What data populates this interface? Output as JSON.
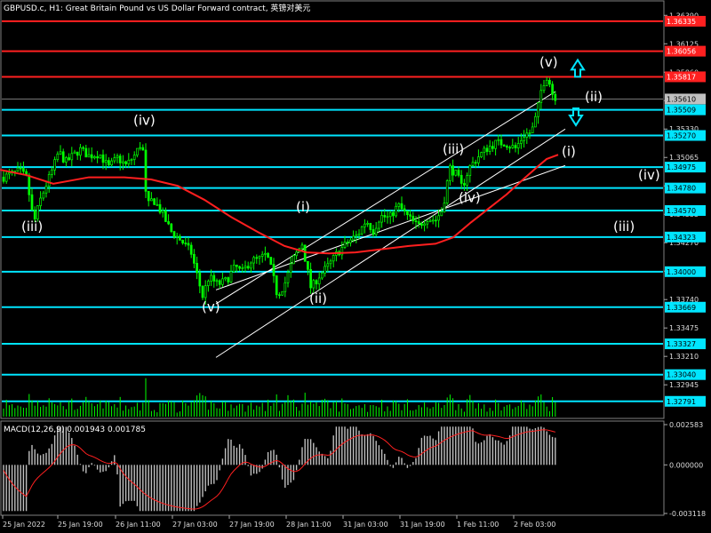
{
  "header": {
    "symbol_info": "GBPUSD.c, H1:  Great Britain Pound vs US Dollar Forward contract, 英镑对美元"
  },
  "macd": {
    "label": "MACD(12,26,9) 0.001943 0.001785",
    "axis_labels": [
      "0.002583",
      "0.000000",
      "-0.003118"
    ]
  },
  "colors": {
    "background": "#000000",
    "candle": "#00ff00",
    "level_line": "#00e5ff",
    "resistance_line": "#ff2020",
    "moving_average": "#ff1f1f",
    "channel": "#ffffff",
    "arrow": "#00e5ff",
    "current_price_bg": "#c0c0c0"
  },
  "chart_data": {
    "type": "candlestick",
    "title": "GBPUSD.c, H1:  Great Britain Pound vs US Dollar Forward contract, 英镑对美元",
    "ylim": [
      1.3264,
      1.365
    ],
    "grid": false,
    "price_axis_ticks": [
      "1.36390",
      "1.36125",
      "1.35860",
      "1.35595",
      "1.35330",
      "1.35065",
      "1.34800",
      "1.34535",
      "1.34270",
      "1.34005",
      "1.33740",
      "1.33475",
      "1.33210",
      "1.32945"
    ],
    "x_ticks": [
      "25 Jan 2022",
      "25 Jan 19:00",
      "26 Jan 11:00",
      "27 Jan 03:00",
      "27 Jan 19:00",
      "28 Jan 11:00",
      "31 Jan 03:00",
      "31 Jan 19:00",
      "1 Feb 11:00",
      "2 Feb 03:00"
    ],
    "current_price": "1.35610",
    "resistance_levels": [
      "1.36335",
      "1.36056",
      "1.35817"
    ],
    "support_levels": [
      "1.35509",
      "1.35270",
      "1.34975",
      "1.34780",
      "1.34570",
      "1.34323",
      "1.34000",
      "1.33669",
      "1.33327",
      "1.33040",
      "1.32791"
    ],
    "price_path": [
      [
        0,
        1.3487
      ],
      [
        10,
        1.349
      ],
      [
        22,
        1.3494
      ],
      [
        30,
        1.3487
      ],
      [
        38,
        1.3445
      ],
      [
        45,
        1.3466
      ],
      [
        52,
        1.3481
      ],
      [
        60,
        1.3497
      ],
      [
        66,
        1.3512
      ],
      [
        74,
        1.3502
      ],
      [
        82,
        1.3508
      ],
      [
        90,
        1.3514
      ],
      [
        100,
        1.3508
      ],
      [
        112,
        1.351
      ],
      [
        122,
        1.3497
      ],
      [
        132,
        1.3506
      ],
      [
        142,
        1.3499
      ],
      [
        152,
        1.3509
      ],
      [
        160,
        1.3522
      ],
      [
        165,
        1.346
      ],
      [
        172,
        1.3468
      ],
      [
        182,
        1.3455
      ],
      [
        192,
        1.3438
      ],
      [
        205,
        1.3428
      ],
      [
        215,
        1.3418
      ],
      [
        228,
        1.3377
      ],
      [
        235,
        1.3395
      ],
      [
        245,
        1.3388
      ],
      [
        255,
        1.3392
      ],
      [
        265,
        1.3405
      ],
      [
        272,
        1.3399
      ],
      [
        282,
        1.341
      ],
      [
        292,
        1.3412
      ],
      [
        300,
        1.3416
      ],
      [
        306,
        1.34
      ],
      [
        312,
        1.3378
      ],
      [
        320,
        1.3388
      ],
      [
        330,
        1.3412
      ],
      [
        340,
        1.3426
      ],
      [
        350,
        1.3384
      ],
      [
        358,
        1.3395
      ],
      [
        370,
        1.3406
      ],
      [
        380,
        1.3418
      ],
      [
        392,
        1.3428
      ],
      [
        402,
        1.3434
      ],
      [
        412,
        1.3448
      ],
      [
        420,
        1.3438
      ],
      [
        428,
        1.3452
      ],
      [
        438,
        1.345
      ],
      [
        448,
        1.3462
      ],
      [
        458,
        1.3452
      ],
      [
        470,
        1.3442
      ],
      [
        480,
        1.345
      ],
      [
        490,
        1.3448
      ],
      [
        498,
        1.3458
      ],
      [
        506,
        1.3497
      ],
      [
        514,
        1.349
      ],
      [
        520,
        1.3478
      ],
      [
        528,
        1.3497
      ],
      [
        538,
        1.3507
      ],
      [
        548,
        1.3515
      ],
      [
        558,
        1.352
      ],
      [
        568,
        1.352
      ],
      [
        580,
        1.3515
      ],
      [
        590,
        1.3528
      ],
      [
        598,
        1.353
      ],
      [
        604,
        1.3547
      ],
      [
        610,
        1.3574
      ],
      [
        616,
        1.3583
      ],
      [
        622,
        1.3565
      ],
      [
        628,
        1.3561
      ]
    ],
    "moving_average_path": [
      [
        0,
        1.3495
      ],
      [
        30,
        1.349
      ],
      [
        60,
        1.3482
      ],
      [
        100,
        1.3488
      ],
      [
        140,
        1.3488
      ],
      [
        170,
        1.3486
      ],
      [
        200,
        1.348
      ],
      [
        230,
        1.3467
      ],
      [
        260,
        1.3451
      ],
      [
        290,
        1.3437
      ],
      [
        320,
        1.3424
      ],
      [
        345,
        1.3418
      ],
      [
        370,
        1.3417
      ],
      [
        400,
        1.3418
      ],
      [
        430,
        1.3421
      ],
      [
        460,
        1.3424
      ],
      [
        490,
        1.3426
      ],
      [
        510,
        1.3432
      ],
      [
        530,
        1.3446
      ],
      [
        550,
        1.3459
      ],
      [
        570,
        1.3472
      ],
      [
        590,
        1.3487
      ],
      [
        605,
        1.3498
      ],
      [
        615,
        1.3505
      ],
      [
        628,
        1.3509
      ]
    ],
    "channel_lines": [
      {
        "from": [
          243,
          1.337
        ],
        "to": [
          625,
          1.3568
        ]
      },
      {
        "from": [
          243,
          1.332
        ],
        "to": [
          636,
          1.3533
        ]
      },
      {
        "from": [
          243,
          1.3383
        ],
        "to": [
          636,
          1.3499
        ]
      }
    ],
    "wave_labels": [
      {
        "text": "(iii)",
        "x": 24,
        "y": 1.3438
      },
      {
        "text": "(iv)",
        "x": 150,
        "y": 1.3537
      },
      {
        "text": "(v)",
        "x": 227,
        "y": 1.3363
      },
      {
        "text": "(i)",
        "x": 333,
        "y": 1.3456
      },
      {
        "text": "(ii)",
        "x": 348,
        "y": 1.3371
      },
      {
        "text": "(iii)",
        "x": 498,
        "y": 1.351
      },
      {
        "text": "(iv)",
        "x": 516,
        "y": 1.3465
      },
      {
        "text": "(v)",
        "x": 607,
        "y": 1.3591
      },
      {
        "text": "(ii)",
        "x": 658,
        "y": 1.3559
      },
      {
        "text": "(i)",
        "x": 632,
        "y": 1.3508
      },
      {
        "text": "(iv)",
        "x": 718,
        "y": 1.3486
      },
      {
        "text": "(iii)",
        "x": 690,
        "y": 1.3438
      }
    ],
    "arrows": [
      {
        "direction": "up",
        "x": 650,
        "y": 1.359
      },
      {
        "direction": "down",
        "x": 648,
        "y": 1.3544
      }
    ],
    "macd": {
      "signal_label": "MACD(12,26,9) 0.001943 0.001785",
      "main": 0.001943,
      "signal": 0.001785,
      "ylim": [
        -0.003118,
        0.002583
      ]
    }
  }
}
